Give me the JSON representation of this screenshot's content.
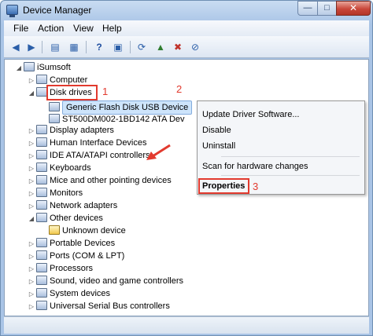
{
  "window": {
    "title": "Device Manager",
    "buttons": {
      "minimize": "—",
      "maximize": "□",
      "close": "✕"
    }
  },
  "menu": [
    "File",
    "Action",
    "View",
    "Help"
  ],
  "toolbar": {
    "icons": [
      "back-icon",
      "forward-icon",
      "tree-view-icon",
      "properties-icon",
      "help-icon",
      "device-view-icon",
      "scan-hardware-icon",
      "update-driver-icon",
      "uninstall-icon",
      "disable-icon"
    ]
  },
  "tree": {
    "root": "iSumsoft",
    "computer": "Computer",
    "disk_drives": "Disk drives",
    "disk_children": [
      "Generic Flash Disk USB Device",
      "ST500DM002-1BD142 ATA Dev"
    ],
    "after_disk": [
      "Display adapters",
      "Human Interface Devices",
      "IDE ATA/ATAPI controllers",
      "Keyboards",
      "Mice and other pointing devices",
      "Monitors",
      "Network adapters"
    ],
    "other_devices": "Other devices",
    "unknown_device": "Unknown device",
    "after_other": [
      "Portable Devices",
      "Ports (COM & LPT)",
      "Processors",
      "Sound, video and game controllers",
      "System devices",
      "Universal Serial Bus controllers"
    ]
  },
  "context_menu": {
    "update": "Update Driver Software...",
    "disable": "Disable",
    "uninstall": "Uninstall",
    "scan": "Scan for hardware changes",
    "properties": "Properties"
  },
  "callouts": {
    "one": "1",
    "two": "2",
    "three": "3"
  },
  "colors": {
    "callout": "#e23a2e",
    "selection": "#cde4fb"
  }
}
